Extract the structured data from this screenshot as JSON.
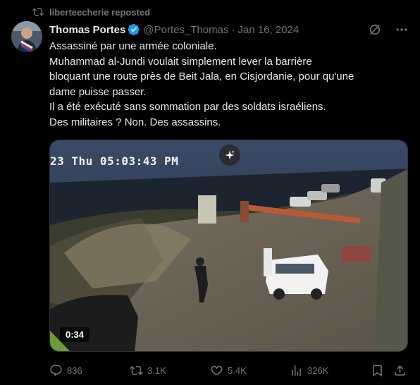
{
  "repost": {
    "label": "liberteecherie reposted",
    "icon": "repost-icon"
  },
  "author": {
    "name": "Thomas Portes",
    "handle": "@Portes_Thomas",
    "separator": "·",
    "date": "Jan 16, 2024",
    "verified_color": "#1d9bf0"
  },
  "tweet": {
    "lines": [
      "Assassiné par une armée coloniale.",
      "Muhammad al-Jundi voulait simplement lever la barrière",
      "bloquant une route près de Beit Jala, en Cisjordanie, pour qu'une",
      "dame puisse passer.",
      "Il a été exécuté sans sommation par des soldats israéliens.",
      "Des militaires ? Non. Des assassins."
    ]
  },
  "media": {
    "video_timestamp": "23 Thu 05:03:43 PM",
    "duration": "0:34",
    "sparkle_icon": "sparkle-icon"
  },
  "actions": {
    "replies": "836",
    "reposts": "3.1K",
    "likes": "5.4K",
    "views": "326K"
  },
  "colors": {
    "background": "#000000",
    "text": "#e7e9ea",
    "muted": "#71767b",
    "accent": "#1d9bf0"
  }
}
